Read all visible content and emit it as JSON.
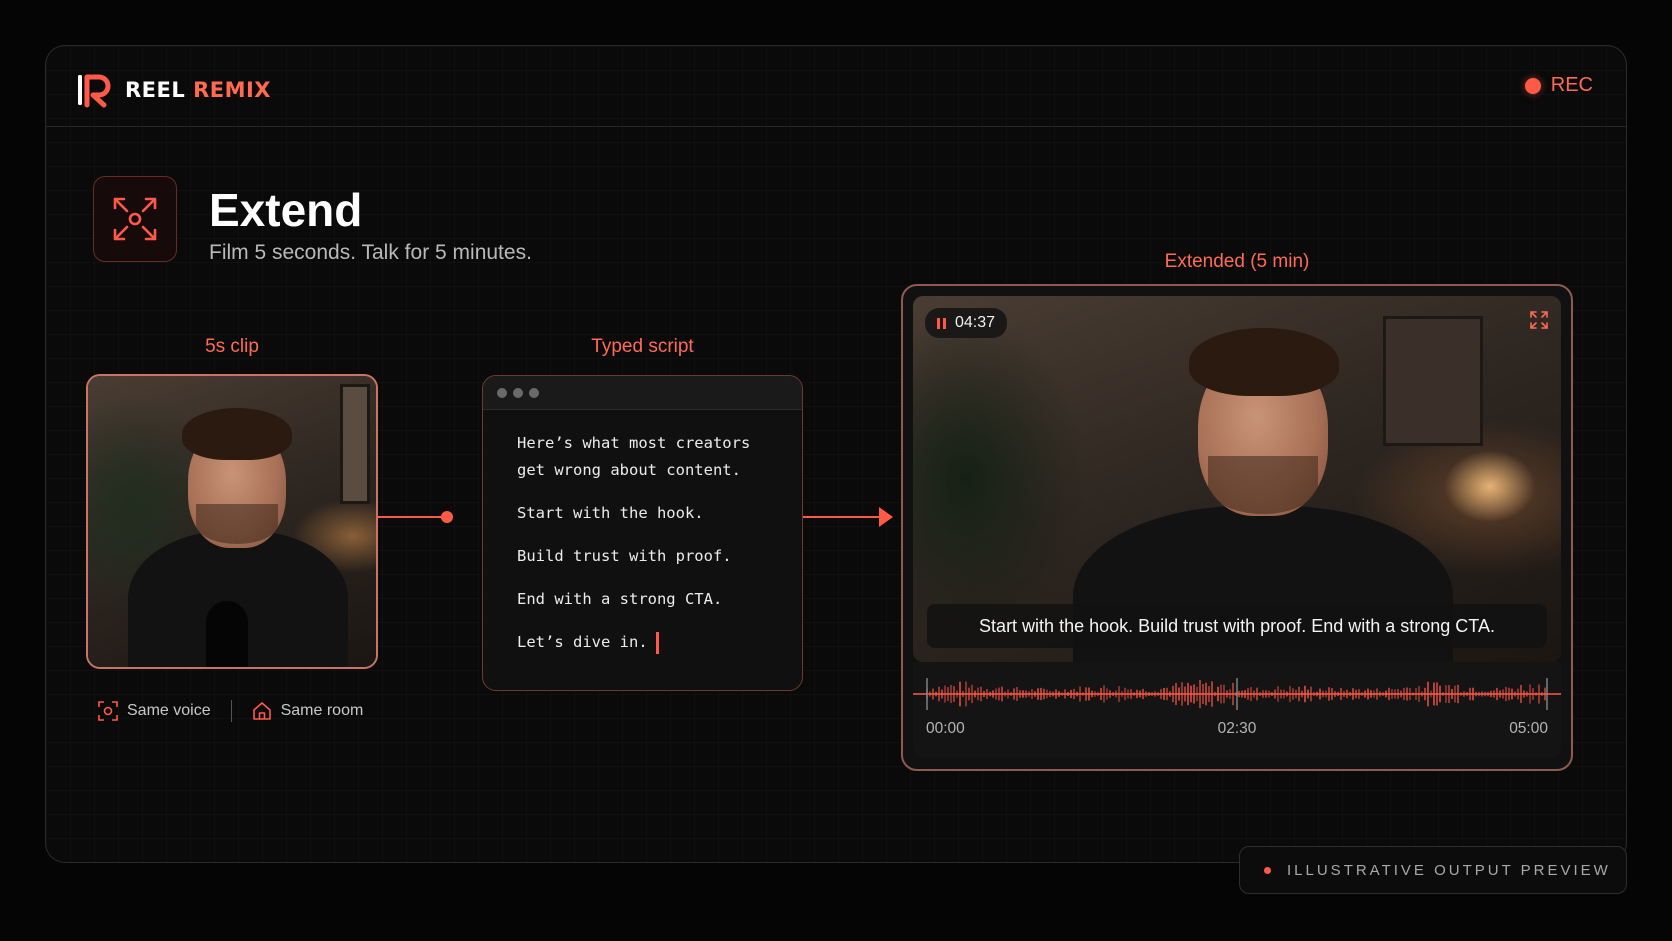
{
  "brand": {
    "name_part1": "REEL",
    "name_part2": "REMIX",
    "rec_label": "REC"
  },
  "feature": {
    "title": "Extend",
    "subtitle": "Film 5 seconds. Talk for 5 minutes.",
    "icon": "expand-arrows-icon"
  },
  "clip": {
    "label": "5s clip",
    "tags": [
      {
        "label": "Same voice",
        "icon": "scan-face-icon"
      },
      {
        "label": "Same room",
        "icon": "home-icon"
      }
    ]
  },
  "script": {
    "label": "Typed script",
    "lines": [
      "Here’s what most creators",
      "get wrong about content.",
      "Start with the hook.",
      "Build trust with proof.",
      "End with a strong CTA.",
      "Let’s dive in."
    ]
  },
  "extended": {
    "label": "Extended (5 min)",
    "timer": "04:37",
    "caption": "Start with the hook. Build trust with proof. End with a strong CTA.",
    "time_start": "00:00",
    "time_mid": "02:30",
    "time_end": "05:00"
  },
  "preview_badge": "ILLUSTRATIVE OUTPUT PREVIEW",
  "colors": {
    "accent": "#ff5a47",
    "background": "#0a0a0a"
  }
}
